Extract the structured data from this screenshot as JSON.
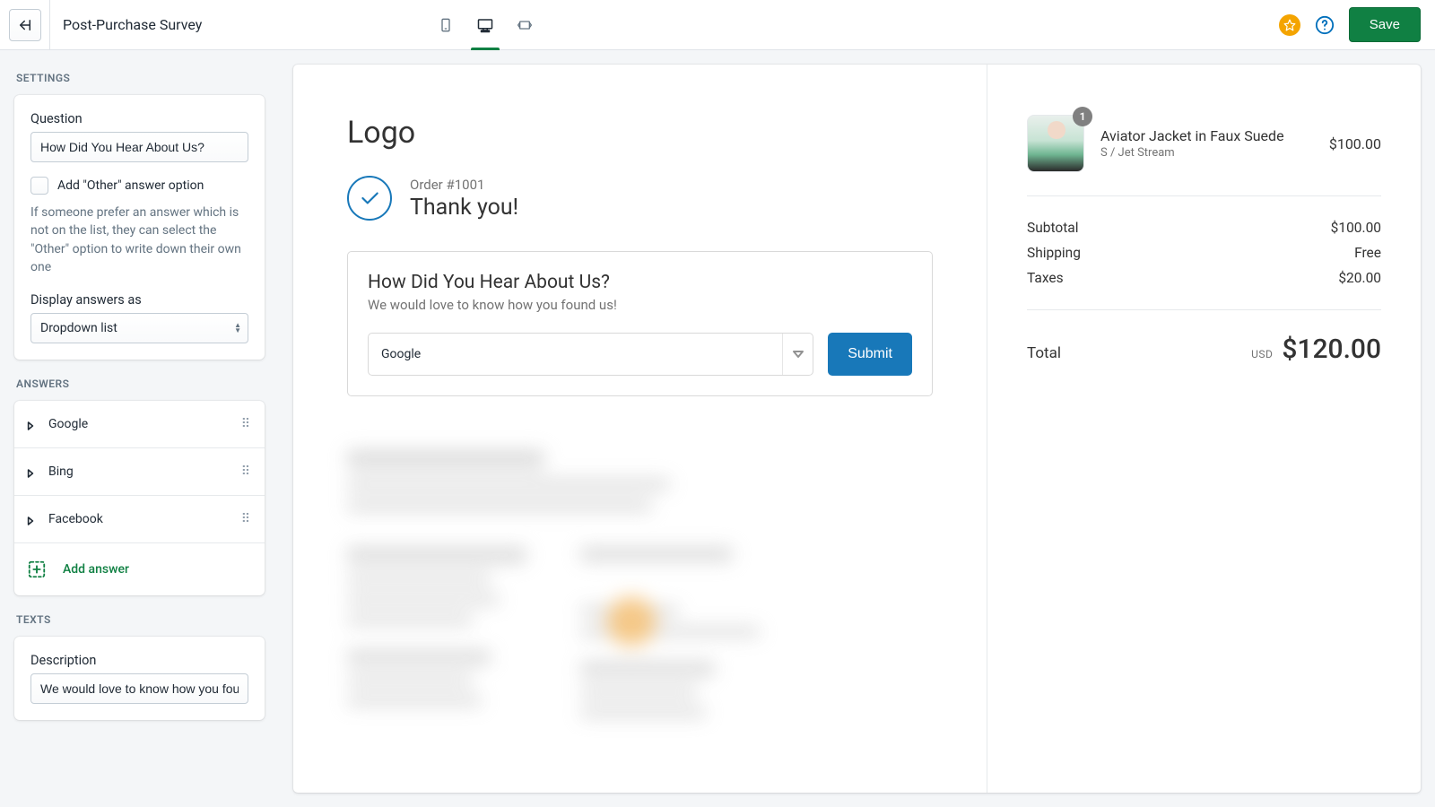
{
  "header": {
    "title": "Post-Purchase Survey",
    "save_label": "Save"
  },
  "settings": {
    "section_label": "SETTINGS",
    "question_label": "Question",
    "question_value": "How Did You Hear About Us?",
    "other_option_label": "Add \"Other\" answer option",
    "other_option_help": "If someone prefer an answer which is not on the list, they can select the \"Other\" option to write down their own one",
    "display_as_label": "Display answers as",
    "display_as_value": "Dropdown list"
  },
  "answers": {
    "section_label": "ANSWERS",
    "items": [
      "Google",
      "Bing",
      "Facebook"
    ],
    "add_label": "Add answer"
  },
  "texts": {
    "section_label": "TEXTS",
    "description_label": "Description",
    "description_value": "We would love to know how you found us!"
  },
  "preview": {
    "logo_text": "Logo",
    "order_number": "Order #1001",
    "thank_you": "Thank you!",
    "survey_question": "How Did You Hear About Us?",
    "survey_description": "We would love to know how you found us!",
    "survey_selected": "Google",
    "submit_label": "Submit"
  },
  "cart": {
    "item": {
      "name": "Aviator Jacket in Faux Suede",
      "variant": "S / Jet Stream",
      "price": "$100.00",
      "qty": "1"
    },
    "subtotal_label": "Subtotal",
    "subtotal_value": "$100.00",
    "shipping_label": "Shipping",
    "shipping_value": "Free",
    "taxes_label": "Taxes",
    "taxes_value": "$20.00",
    "total_label": "Total",
    "currency": "USD",
    "total_value": "$120.00"
  }
}
